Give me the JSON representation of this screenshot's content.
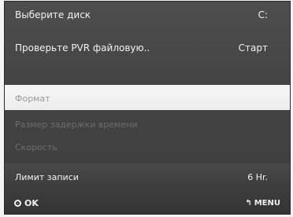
{
  "menu": {
    "items": [
      {
        "label": "Выберите диск",
        "value": "C:"
      },
      {
        "label": "Проверьте PVR файловую..",
        "value": "Старт"
      },
      {
        "label": "Формат",
        "value": ""
      },
      {
        "label": "Размер задержки времени",
        "value": ""
      },
      {
        "label": "Скорость",
        "value": ""
      },
      {
        "label": "Лимит записи",
        "value": "6 Hr."
      }
    ],
    "selected_index": 2
  },
  "footer": {
    "ok_label": "OK",
    "menu_label": "MENU",
    "ok_icon": "circle-ok-icon",
    "menu_icon": "return-arrow-icon"
  }
}
